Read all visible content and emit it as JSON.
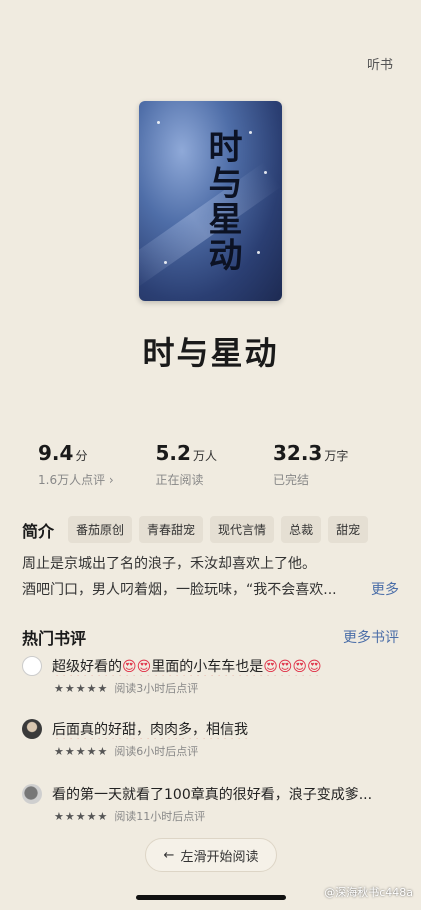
{
  "header": {
    "listen_label": "听书"
  },
  "book": {
    "title": "时与星动",
    "cover_title": "时与星动"
  },
  "stats": [
    {
      "value": "9.4",
      "unit": "分",
      "sub": "1.6万人点评 ›"
    },
    {
      "value": "5.2",
      "unit": "万人",
      "sub": "正在阅读"
    },
    {
      "value": "32.3",
      "unit": "万字",
      "sub": "已完结"
    }
  ],
  "intro": {
    "heading": "简介",
    "tags": [
      "番茄原创",
      "青春甜宠",
      "现代言情",
      "总裁",
      "甜宠"
    ],
    "line1": "周止是京城出了名的浪子，禾汝却喜欢上了他。",
    "line2": "酒吧门口，男人叼着烟，一脸玩味，“我不会喜欢...",
    "more": "更多"
  },
  "reviews": {
    "heading": "热门书评",
    "more": "更多书评",
    "items": [
      {
        "text_a": "超级好看的",
        "emoji_a": "😍😍",
        "text_b": "里面的小车车也是",
        "emoji_b": "😍😍😍😍",
        "stars": "★★★★★",
        "meta": "阅读3小时后点评"
      },
      {
        "text": "后面真的好甜，肉肉多，相信我",
        "stars": "★★★★★",
        "meta": "阅读6小时后点评"
      },
      {
        "text": "看的第一天就看了100章真的很好看，浪子变成爹...",
        "stars": "★★★★★",
        "meta": "阅读11小时后点评"
      }
    ]
  },
  "cta": {
    "label": "左滑开始阅读",
    "arrow": "←"
  },
  "watermark": "@深海秋书c448a"
}
